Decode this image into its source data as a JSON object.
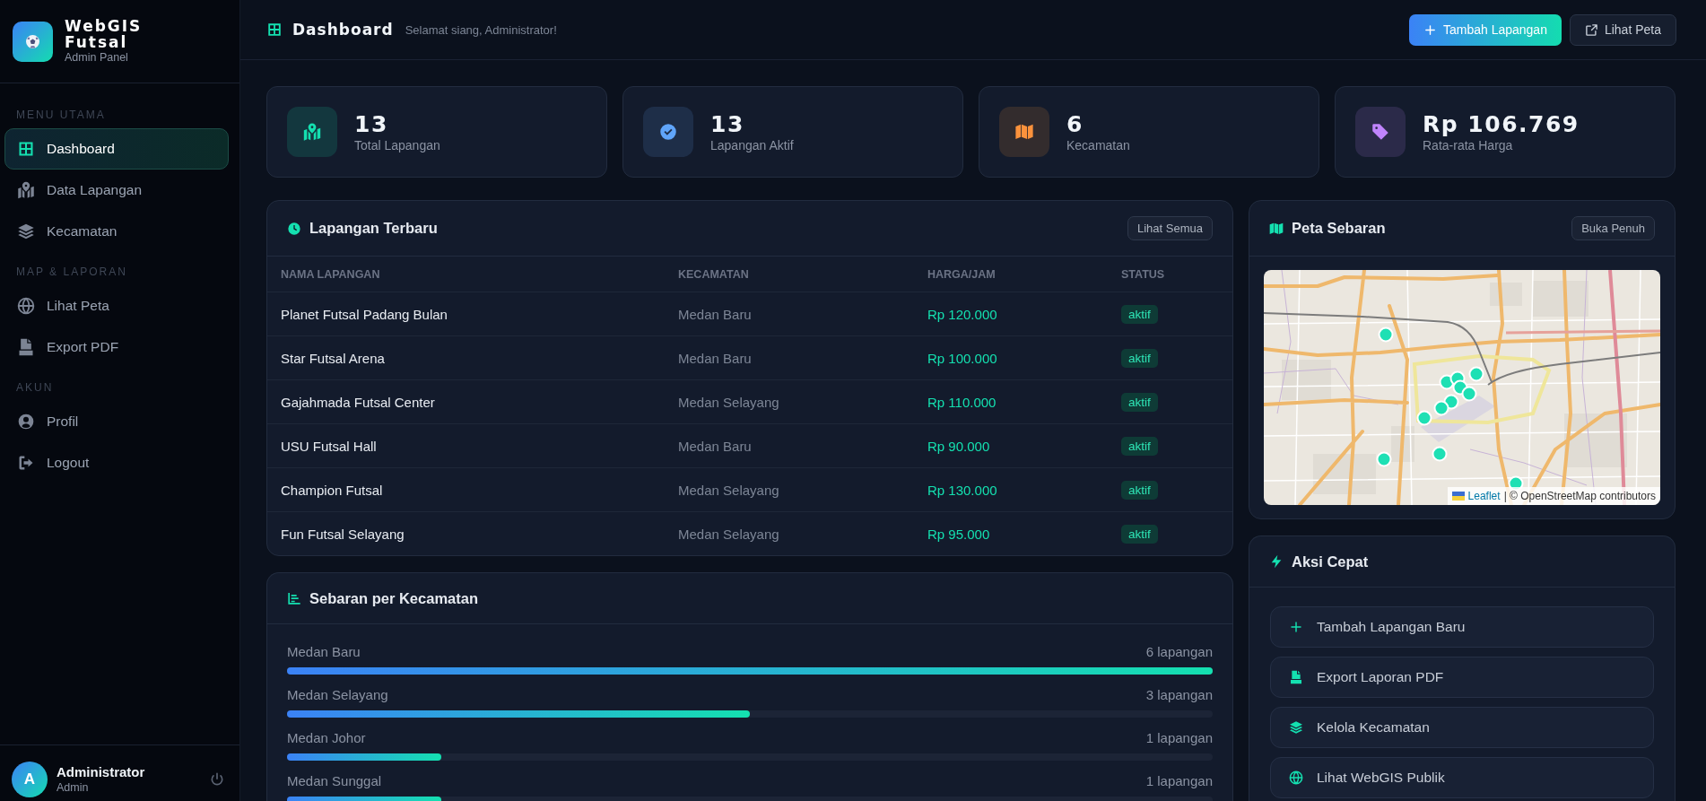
{
  "sidebar": {
    "brand": {
      "title": "WebGIS Futsal",
      "subtitle": "Admin Panel"
    },
    "sections": [
      {
        "label": "MENU UTAMA",
        "items": [
          {
            "label": "Dashboard",
            "selected": true
          },
          {
            "label": "Data Lapangan",
            "selected": false
          },
          {
            "label": "Kecamatan",
            "selected": false
          }
        ]
      },
      {
        "label": "MAP & LAPORAN",
        "items": [
          {
            "label": "Lihat Peta",
            "selected": false
          },
          {
            "label": "Export PDF",
            "selected": false
          }
        ]
      },
      {
        "label": "AKUN",
        "items": [
          {
            "label": "Profil",
            "selected": false
          },
          {
            "label": "Logout",
            "selected": false
          }
        ]
      }
    ],
    "user": {
      "initial": "A",
      "name": "Administrator",
      "role": "Admin"
    }
  },
  "header": {
    "title": "Dashboard",
    "greeting": "Selamat siang, Administrator!",
    "buttons": [
      {
        "label": "Tambah Lapangan",
        "kind": "primary"
      },
      {
        "label": "Lihat Peta",
        "kind": "secondary"
      }
    ]
  },
  "stats": [
    {
      "value": "13",
      "label": "Total Lapangan",
      "color": "#14e0b0"
    },
    {
      "value": "13",
      "label": "Lapangan Aktif",
      "color": "#60a5fa"
    },
    {
      "value": "6",
      "label": "Kecamatan",
      "color": "#fb923c"
    },
    {
      "value": "Rp 106.769",
      "label": "Rata-rata Harga",
      "color": "#c084fc"
    }
  ],
  "latest_fields": {
    "title": "Lapangan Terbaru",
    "action": "Lihat Semua",
    "columns": [
      "NAMA LAPANGAN",
      "KECAMATAN",
      "HARGA/JAM",
      "STATUS"
    ],
    "rows": [
      {
        "name": "Planet Futsal Padang Bulan",
        "district": "Medan Baru",
        "price": "Rp 120.000",
        "status": "aktif"
      },
      {
        "name": "Star Futsal Arena",
        "district": "Medan Baru",
        "price": "Rp 100.000",
        "status": "aktif"
      },
      {
        "name": "Gajahmada Futsal Center",
        "district": "Medan Selayang",
        "price": "Rp 110.000",
        "status": "aktif"
      },
      {
        "name": "USU Futsal Hall",
        "district": "Medan Baru",
        "price": "Rp 90.000",
        "status": "aktif"
      },
      {
        "name": "Champion Futsal",
        "district": "Medan Selayang",
        "price": "Rp 130.000",
        "status": "aktif"
      },
      {
        "name": "Fun Futsal Selayang",
        "district": "Medan Selayang",
        "price": "Rp 95.000",
        "status": "aktif"
      }
    ]
  },
  "map": {
    "title": "Peta Sebaran",
    "action": "Buka Penuh",
    "attribution": {
      "link": "Leaflet",
      "text": "| © OpenStreetMap contributors"
    }
  },
  "distribution": {
    "title": "Sebaran per Kecamatan",
    "items": [
      {
        "name": "Medan Baru",
        "count": "6 lapangan",
        "level": 1
      },
      {
        "name": "Medan Selayang",
        "count": "3 lapangan",
        "level": 0.5
      },
      {
        "name": "Medan Johor",
        "count": "1 lapangan",
        "level": 0.1667
      },
      {
        "name": "Medan Sunggal",
        "count": "1 lapangan",
        "level": 0.1667
      }
    ]
  },
  "quick_actions": {
    "title": "Aksi Cepat",
    "items": [
      "Tambah Lapangan Baru",
      "Export Laporan PDF",
      "Kelola Kecamatan",
      "Lihat WebGIS Publik"
    ]
  }
}
